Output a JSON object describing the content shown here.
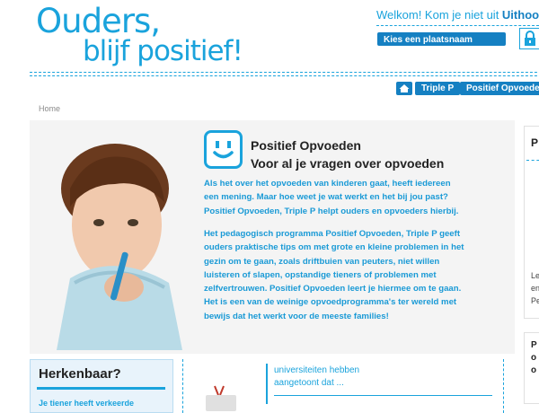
{
  "header": {
    "logo_line1": "Ouders,",
    "logo_line2": "blijf positief!",
    "welcome_text": "Welkom! Kom je niet uit ",
    "welcome_place": "Uithoorn?",
    "choose_place_button": "Kies een plaatsnaam"
  },
  "nav": {
    "items": [
      "Triple P",
      "Positief Opvoeden"
    ]
  },
  "breadcrumb": {
    "home": "Home"
  },
  "article": {
    "title_line1": "Positief Opvoeden",
    "title_line2": "Voor al je vragen over opvoeden",
    "paragraph1": "Als het over het opvoeden van kinderen gaat, heeft iedereen een mening. Maar hoe weet je wat werkt en het bij jou past? Positief Opvoeden, Triple P helpt ouders en opvoeders hierbij.",
    "paragraph2": "Het pedagogisch programma Positief Opvoeden, Triple P geeft ouders praktische tips om met grote en kleine problemen in het gezin om te gaan, zoals driftbuien van peuters, niet willen luisteren of slapen, opstandige tieners of problemen met zelfvertrouwen. Positief Opvoeden leert je hiermee om te gaan. Het is een van de weinige opvoedprogramma's ter wereld met bewijs dat het werkt voor de meeste families!"
  },
  "right_column": {
    "heading_fragment": "P",
    "text_fragments": [
      "Le",
      "en",
      "Pe"
    ],
    "heading2_fragments": [
      "P",
      "o",
      "o"
    ]
  },
  "bottom": {
    "herkenbaar_title": "Herkenbaar?",
    "herkenbaar_text": "Je tiener heeft verkeerde",
    "quote_line1": "universiteiten hebben",
    "quote_line2": "aangetoont dat ..."
  },
  "colors": {
    "accent": "#1aa3dc",
    "button": "#1580c2"
  }
}
